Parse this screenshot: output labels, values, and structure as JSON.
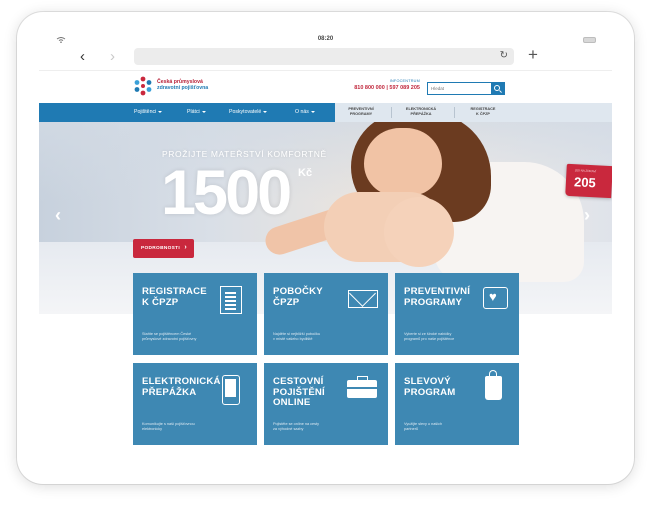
{
  "status_bar": {
    "time": "08:20"
  },
  "header": {
    "logo_line1": "Česká průmyslová",
    "logo_line2": "zdravotní pojišťovna",
    "info_label": "INFOCENTRUM",
    "info_phone": "810 800 000 | 597 089 205",
    "search_placeholder": "Hledat"
  },
  "nav": {
    "items": [
      {
        "label": "Pojištěnci"
      },
      {
        "label": "Plátci"
      },
      {
        "label": "Poskytovatelé"
      },
      {
        "label": "O nás"
      }
    ],
    "secondary": [
      {
        "line1": "PREVENTIVNÍ",
        "line2": "PROGRAMY"
      },
      {
        "line1": "ELEKTRONICKÁ",
        "line2": "PŘEPÁŽKA"
      },
      {
        "line1": "REGISTRACE",
        "line2": "K ČPZP"
      }
    ]
  },
  "hero": {
    "subtitle": "PROŽIJTE MATEŘSTVÍ KOMFORTNĚ",
    "amount": "1500",
    "currency": "Kč",
    "cta_label": "PODROBNOSTI",
    "ribbon_label": "205 NA ZDRAVÍ",
    "ribbon_number": "205"
  },
  "tiles": [
    {
      "title_line1": "REGISTRACE",
      "title_line2": "K ČPZP",
      "title_line3": "",
      "desc_line1": "Staňte se pojištěncem České",
      "desc_line2": "průmyslové zdravotní pojišťovny",
      "icon": "document-icon"
    },
    {
      "title_line1": "POBOČKY",
      "title_line2": "ČPZP",
      "title_line3": "",
      "desc_line1": "Najděte si nejbližší pobočku",
      "desc_line2": "v místě vašeho bydliště",
      "icon": "mail-icon"
    },
    {
      "title_line1": "PREVENTIVNÍ",
      "title_line2": "PROGRAMY",
      "title_line3": "",
      "desc_line1": "Vyberte si ze široké nabídky",
      "desc_line2": "programů pro naše pojištěnce",
      "icon": "heart-icon"
    },
    {
      "title_line1": "ELEKTRONICKÁ",
      "title_line2": "PŘEPÁŽKA",
      "title_line3": "",
      "desc_line1": "Komunikujte s naší pojišťovnou",
      "desc_line2": "elektronicky",
      "icon": "phone-icon"
    },
    {
      "title_line1": "CESTOVNÍ",
      "title_line2": "POJIŠTĚNÍ",
      "title_line3": "ONLINE",
      "desc_line1": "Pojistěte se online na cesty",
      "desc_line2": "za výhodné sazby",
      "icon": "briefcase-icon"
    },
    {
      "title_line1": "SLEVOVÝ",
      "title_line2": "PROGRAM",
      "title_line3": "",
      "desc_line1": "Využijte slevy u našich",
      "desc_line2": "partnerů",
      "icon": "shopping-bag-icon"
    }
  ],
  "colors": {
    "brand_blue": "#1f7ab3",
    "tile_blue": "#3e88b3",
    "accent_red": "#c9283d"
  }
}
